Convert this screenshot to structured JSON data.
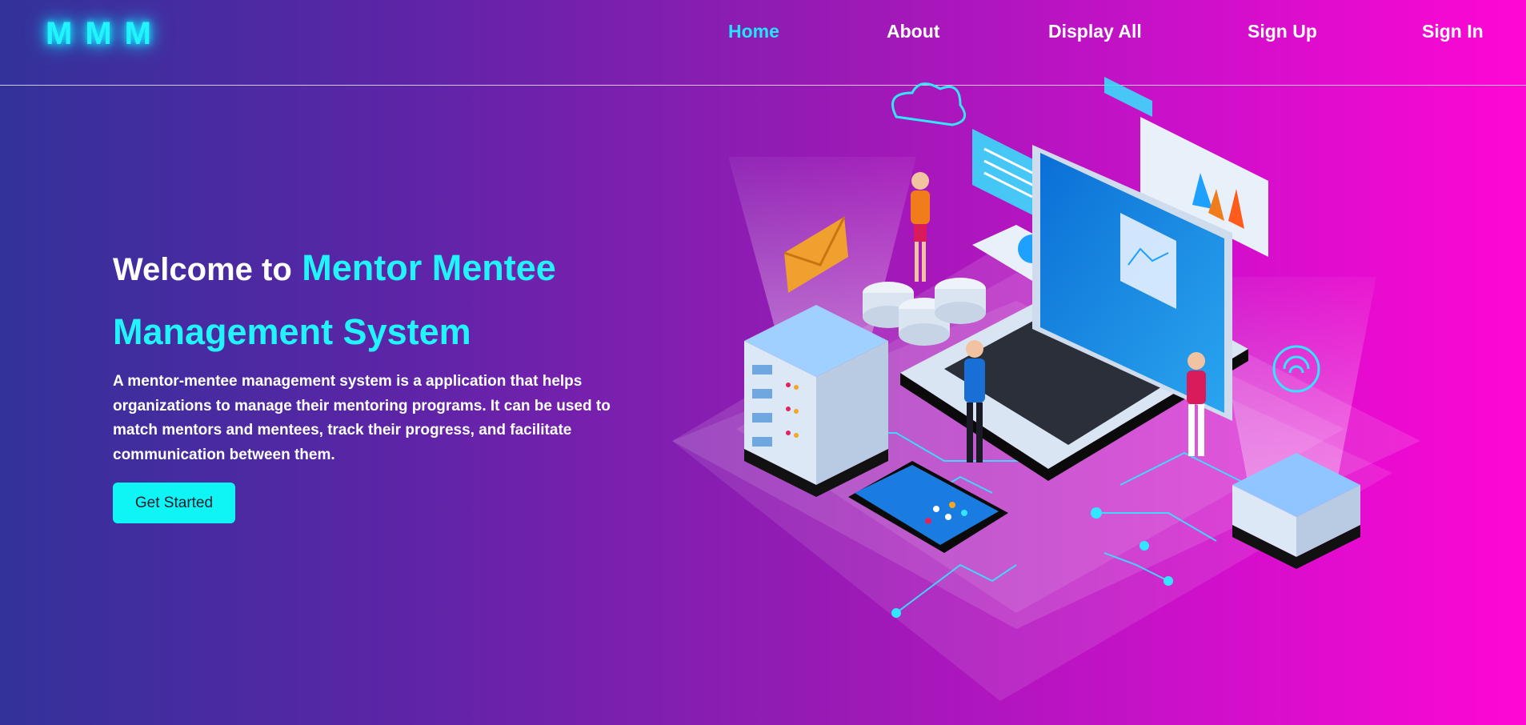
{
  "brand": {
    "logo": "MMM"
  },
  "nav": {
    "home": "Home",
    "about": "About",
    "display_all": "Display All",
    "sign_up": "Sign Up",
    "sign_in": "Sign In",
    "active": "Home"
  },
  "hero": {
    "title_lead": "Welcome to",
    "title_accent_line1": "Mentor Mentee",
    "title_accent_line2": "Management System",
    "description": "A mentor-mentee management system is a application that helps organizations to manage their mentoring programs. It can be used to match mentors and mentees, track their progress, and facilitate communication between them.",
    "cta_label": "Get Started"
  },
  "colors": {
    "accent": "#22f4ff",
    "gradient_start": "#33329a",
    "gradient_end": "#ff07d4",
    "button": "#0ff5f5"
  },
  "icons": [
    "envelope-icon",
    "cloud-icon",
    "wifi-icon",
    "pie-chart-icon",
    "bar-chart-icon"
  ]
}
